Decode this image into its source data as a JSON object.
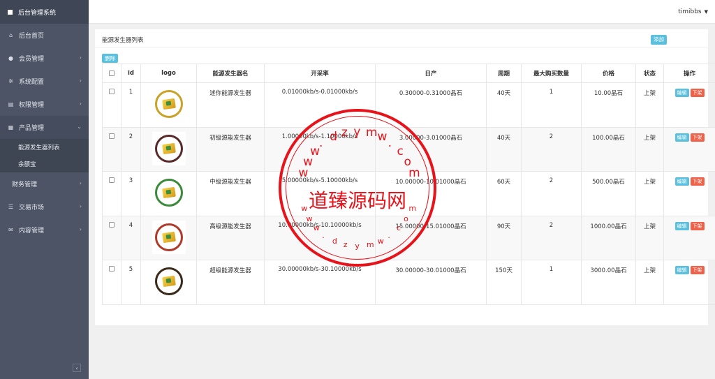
{
  "app": {
    "title": "后台管理系统",
    "user": "timibbs"
  },
  "sidebar": {
    "items": [
      {
        "label": "后台首页",
        "icon": "home-icon",
        "chevron": false
      },
      {
        "label": "会员管理",
        "icon": "user-icon",
        "chevron": true
      },
      {
        "label": "系统配置",
        "icon": "gears-icon",
        "chevron": true
      },
      {
        "label": "权限管理",
        "icon": "list-icon",
        "chevron": true
      },
      {
        "label": "产品管理",
        "icon": "windows-icon",
        "chevron": true
      }
    ],
    "subitems": [
      "能源发生器列表",
      "余额宝"
    ],
    "items_after": [
      {
        "label": "财务管理",
        "icon": "",
        "chevron": true
      },
      {
        "label": "交易市场",
        "icon": "bars-icon",
        "chevron": true
      },
      {
        "label": "内容管理",
        "icon": "envelope-icon",
        "chevron": true
      }
    ],
    "collapse_symbol": "‹"
  },
  "panel": {
    "title": "能源发生器列表",
    "add_label": "添加",
    "delete_label": "删除"
  },
  "table": {
    "headers": [
      "",
      "id",
      "logo",
      "能源发生器名",
      "开采率",
      "日产",
      "周期",
      "最大购买数量",
      "价格",
      "状态",
      "操作"
    ],
    "rows": [
      {
        "id": "1",
        "name": "迷你能源发生器",
        "rate": "0.01000kb/s-0.01000kb/s",
        "daily": "0.30000-0.31000晶石",
        "period": "40天",
        "max": "1",
        "price": "10.00晶石",
        "status": "上架",
        "ring": "#c9a227"
      },
      {
        "id": "2",
        "name": "初级源能发生器",
        "rate": "1.00000kb/s-1.10000kb/s",
        "daily": "3.00000-3.01000晶石",
        "period": "40天",
        "max": "2",
        "price": "100.00晶石",
        "status": "上架",
        "ring": "#5a2a2a"
      },
      {
        "id": "3",
        "name": "中级源能发生器",
        "rate": "5.00000kb/s-5.10000kb/s",
        "daily": "10.00000-10.01000晶石",
        "period": "60天",
        "max": "2",
        "price": "500.00晶石",
        "status": "上架",
        "ring": "#3a8a3a"
      },
      {
        "id": "4",
        "name": "高级源能发生器",
        "rate": "10.00000kb/s-10.10000kb/s",
        "daily": "15.00000-15.01000晶石",
        "period": "90天",
        "max": "2",
        "price": "1000.00晶石",
        "status": "上架",
        "ring": "#b03a2a"
      },
      {
        "id": "5",
        "name": "超级能源发生器",
        "rate": "30.00000kb/s-30.10000kb/s",
        "daily": "30.00000-30.01000晶石",
        "period": "150天",
        "max": "1",
        "price": "3000.00晶石",
        "status": "上架",
        "ring": "#3a2a1a"
      }
    ],
    "edit_label": "编辑",
    "off_label": "下架"
  },
  "watermark": {
    "text": "道臻源码网",
    "url_top": "www.dzymw.com",
    "url_bottom": "www.dzymw.com"
  },
  "colors": {
    "sidebar": "#4c5466",
    "accent": "#5bc0de",
    "danger": "#f0614a",
    "stamp": "#e8121a"
  }
}
